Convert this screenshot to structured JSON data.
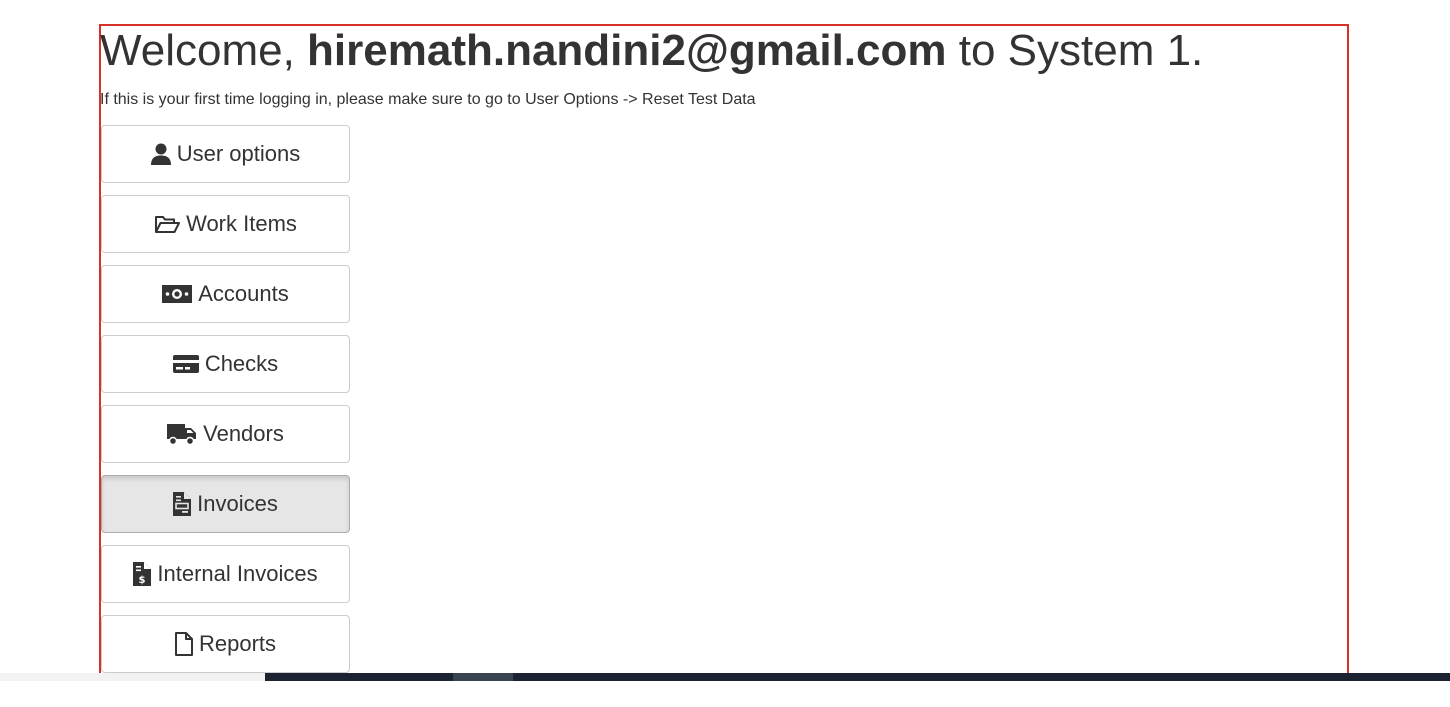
{
  "header": {
    "welcome_prefix": "Welcome, ",
    "user_email": "hiremath.nandini2@gmail.com",
    "welcome_suffix": " to System 1.",
    "hint": "If this is your first time logging in, please make sure to go to User Options -> Reset Test Data"
  },
  "menu": {
    "items": [
      {
        "label": "User options",
        "icon": "user-icon"
      },
      {
        "label": "Work Items",
        "icon": "folder-open-icon"
      },
      {
        "label": "Accounts",
        "icon": "money-bill-icon"
      },
      {
        "label": "Checks",
        "icon": "credit-card-icon"
      },
      {
        "label": "Vendors",
        "icon": "truck-icon"
      },
      {
        "label": "Invoices",
        "icon": "file-invoice-icon",
        "active": true
      },
      {
        "label": "Internal Invoices",
        "icon": "file-invoice-dollar-icon"
      },
      {
        "label": "Reports",
        "icon": "file-icon"
      }
    ]
  },
  "colors": {
    "frame_border": "#d9302c",
    "active_button_bg": "#e6e6e6",
    "text": "#333333"
  }
}
